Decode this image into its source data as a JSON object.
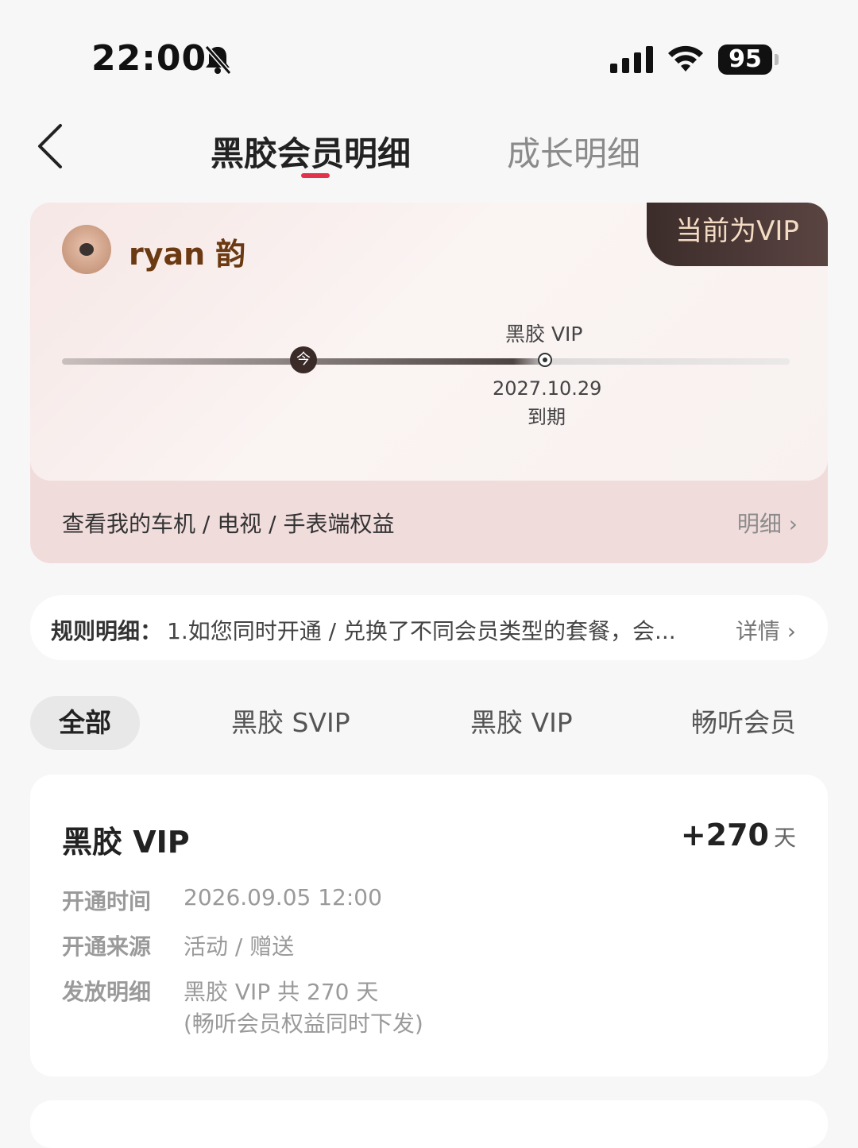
{
  "status_bar": {
    "time": "22:00",
    "battery": "95",
    "icons": [
      "bell-slash-icon",
      "signal-icon",
      "wifi-icon",
      "battery-icon"
    ]
  },
  "nav": {
    "tabs": [
      "黑胶会员明细",
      "成长明细"
    ],
    "active_tab": 0,
    "accent_color": "#e3334b"
  },
  "member_card": {
    "tag": "当前为VIP",
    "username": "ryan 韵",
    "timeline": {
      "today_label": "今",
      "vip_label": "黑胶 VIP",
      "end_date": "2027.10.29",
      "end_text": "到期"
    },
    "device_rights": "查看我的车机 / 电视 / 手表端权益",
    "detail_link": "明细"
  },
  "rules": {
    "title": "规则明细：",
    "text": "1.如您同时开通 / 兑换了不同会员类型的套餐，会...",
    "more": "详情"
  },
  "filters": [
    "全部",
    "黑胶 SVIP",
    "黑胶 VIP",
    "畅听会员"
  ],
  "record": {
    "title": "黑胶 VIP",
    "days": "+270",
    "unit": "天",
    "rows": [
      {
        "label": "开通时间",
        "value": "2026.09.05 12:00"
      },
      {
        "label": "开通来源",
        "value": "活动 / 赠送"
      },
      {
        "label": "发放明细",
        "value": "黑胶 VIP 共 270 天",
        "value2": "(畅听会员权益同时下发)"
      }
    ]
  }
}
